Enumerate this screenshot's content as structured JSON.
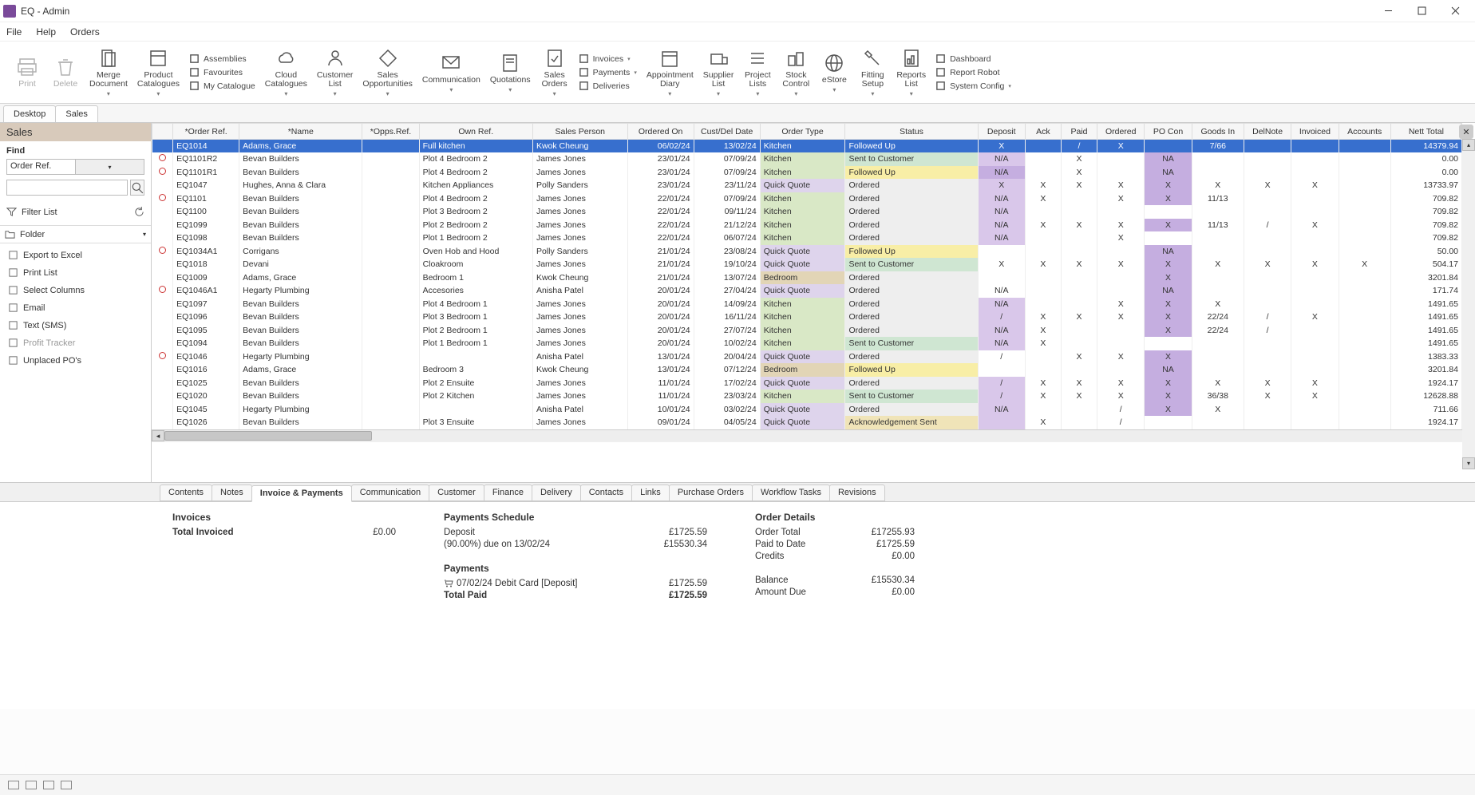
{
  "window": {
    "title": "EQ  -  Admin"
  },
  "menu": [
    "File",
    "Help",
    "Orders"
  ],
  "ribbon_main": [
    {
      "id": "print",
      "label": "Print",
      "disabled": true,
      "drop": false
    },
    {
      "id": "delete",
      "label": "Delete",
      "disabled": true,
      "drop": false
    },
    {
      "id": "merge",
      "label": "Merge\nDocument",
      "drop": true
    },
    {
      "id": "product-cat",
      "label": "Product\nCatalogues",
      "drop": true
    }
  ],
  "ribbon_side1": [
    {
      "id": "assemblies",
      "label": "Assemblies"
    },
    {
      "id": "favourites",
      "label": "Favourites"
    },
    {
      "id": "my-catalogue",
      "label": "My Catalogue"
    }
  ],
  "ribbon_mid": [
    {
      "id": "cloud-cat",
      "label": "Cloud\nCatalogues",
      "drop": true
    },
    {
      "id": "cust-list",
      "label": "Customer\nList",
      "drop": true
    },
    {
      "id": "sales-opp",
      "label": "Sales\nOpportunities",
      "drop": true
    },
    {
      "id": "comm",
      "label": "Communication",
      "drop": true
    },
    {
      "id": "quot",
      "label": "Quotations",
      "drop": true
    },
    {
      "id": "sales-orders",
      "label": "Sales\nOrders",
      "drop": true
    }
  ],
  "ribbon_side2": [
    {
      "id": "invoices",
      "label": "Invoices",
      "drop": true
    },
    {
      "id": "payments",
      "label": "Payments",
      "drop": true
    },
    {
      "id": "deliveries",
      "label": "Deliveries"
    }
  ],
  "ribbon_tail": [
    {
      "id": "appt-diary",
      "label": "Appointment\nDiary",
      "drop": true
    },
    {
      "id": "supplier-list",
      "label": "Supplier\nList",
      "drop": true
    },
    {
      "id": "project-lists",
      "label": "Project\nLists",
      "drop": true
    },
    {
      "id": "stock-ctrl",
      "label": "Stock\nControl",
      "drop": true
    },
    {
      "id": "estore",
      "label": "eStore",
      "drop": true
    },
    {
      "id": "fitting-setup",
      "label": "Fitting\nSetup",
      "drop": true
    },
    {
      "id": "reports-list",
      "label": "Reports\nList",
      "drop": true
    }
  ],
  "ribbon_side3": [
    {
      "id": "dashboard",
      "label": "Dashboard"
    },
    {
      "id": "report-robot",
      "label": "Report Robot"
    },
    {
      "id": "system-config",
      "label": "System Config",
      "drop": true
    }
  ],
  "tabs": {
    "items": [
      "Desktop",
      "Sales"
    ],
    "active": 1
  },
  "left": {
    "title": "Sales",
    "find_label": "Find",
    "find_field": "Order Ref.",
    "filter_label": "Filter List",
    "folder": "Folder",
    "actions": [
      {
        "id": "export-excel",
        "label": "Export to Excel"
      },
      {
        "id": "print-list",
        "label": "Print List"
      },
      {
        "id": "select-cols",
        "label": "Select Columns"
      },
      {
        "id": "email",
        "label": "Email"
      },
      {
        "id": "text-sms",
        "label": "Text (SMS)"
      },
      {
        "id": "profit-tracker",
        "label": "Profit Tracker",
        "disabled": true
      },
      {
        "id": "unplaced-pos",
        "label": "Unplaced PO's"
      }
    ]
  },
  "grid": {
    "columns": [
      "",
      "*Order Ref.",
      "*Name",
      "*Opps.Ref.",
      "Own Ref.",
      "Sales Person",
      "Ordered On",
      "Cust/Del Date",
      "Order Type",
      "Status",
      "Deposit",
      "Ack",
      "Paid",
      "Ordered",
      "PO Con",
      "Goods In",
      "DelNote",
      "Invoiced",
      "Accounts",
      "Nett Total"
    ],
    "rows": [
      {
        "r": "",
        "ref": "EQ1014",
        "name": "Adams, Grace",
        "opps": "",
        "own": "Full kitchen",
        "sp": "Kwok Cheung",
        "ord": "06/02/24",
        "del": "13/02/24",
        "ot": "Kitchen",
        "otc": "ot-kitchen",
        "st": "Followed Up",
        "stc": "st-followed",
        "dep": "X",
        "ack": "",
        "paid": "/",
        "ordered": "X",
        "po": "",
        "gi": "7/66",
        "dn": "",
        "inv": "",
        "acc": "",
        "net": "14379.94",
        "sel": true
      },
      {
        "r": "o",
        "ref": "EQ1101R2",
        "name": "Bevan Builders",
        "own": "Plot 4 Bedroom 2",
        "sp": "James Jones",
        "ord": "23/01/24",
        "del": "07/09/24",
        "ot": "Kitchen",
        "otc": "ot-kitchen",
        "st": "Sent to Customer",
        "stc": "st-sent",
        "dep": "N/A",
        "depc": "dep-purple",
        "ack": "",
        "paid": "X",
        "ordered": "",
        "po": "NA",
        "poc": "po-purple",
        "gi": "",
        "dn": "",
        "inv": "",
        "acc": "",
        "net": "0.00"
      },
      {
        "r": "o",
        "ref": "EQ1101R1",
        "name": "Bevan Builders",
        "own": "Plot 4 Bedroom 2",
        "sp": "James Jones",
        "ord": "23/01/24",
        "del": "07/09/24",
        "ot": "Kitchen",
        "otc": "ot-kitchen",
        "st": "Followed Up",
        "stc": "st-followed",
        "dep": "N/A",
        "depc": "dep-purple-dk",
        "ack": "",
        "paid": "X",
        "ordered": "",
        "po": "NA",
        "poc": "po-purple",
        "gi": "",
        "dn": "",
        "inv": "",
        "acc": "",
        "net": "0.00"
      },
      {
        "r": "",
        "ref": "EQ1047",
        "name": "Hughes, Anna & Clara",
        "own": "Kitchen Appliances",
        "sp": "Polly Sanders",
        "ord": "23/01/24",
        "del": "23/11/24",
        "ot": "Quick Quote",
        "otc": "ot-quick",
        "st": "Ordered",
        "stc": "st-ordered",
        "dep": "X",
        "depc": "dep-purple",
        "ack": "X",
        "paid": "X",
        "ordered": "X",
        "po": "X",
        "poc": "po-purple",
        "gi": "X",
        "dn": "X",
        "inv": "X",
        "acc": "",
        "net": "13733.97"
      },
      {
        "r": "o",
        "ref": "EQ1101",
        "name": "Bevan Builders",
        "own": "Plot 4 Bedroom 2",
        "sp": "James Jones",
        "ord": "22/01/24",
        "del": "07/09/24",
        "ot": "Kitchen",
        "otc": "ot-kitchen",
        "st": "Ordered",
        "stc": "st-ordered",
        "dep": "N/A",
        "depc": "dep-purple",
        "ack": "X",
        "paid": "",
        "ordered": "X",
        "po": "X",
        "poc": "po-purple",
        "gi": "11/13",
        "dn": "",
        "inv": "",
        "acc": "",
        "net": "709.82"
      },
      {
        "r": "",
        "ref": "EQ1100",
        "name": "Bevan Builders",
        "own": "Plot 3 Bedroom 2",
        "sp": "James Jones",
        "ord": "22/01/24",
        "del": "09/11/24",
        "ot": "Kitchen",
        "otc": "ot-kitchen",
        "st": "Ordered",
        "stc": "st-ordered",
        "dep": "N/A",
        "depc": "dep-purple",
        "ack": "",
        "paid": "",
        "ordered": "",
        "po": "",
        "gi": "",
        "dn": "",
        "inv": "",
        "acc": "",
        "net": "709.82"
      },
      {
        "r": "",
        "ref": "EQ1099",
        "name": "Bevan Builders",
        "own": "Plot 2 Bedroom 2",
        "sp": "James Jones",
        "ord": "22/01/24",
        "del": "21/12/24",
        "ot": "Kitchen",
        "otc": "ot-kitchen",
        "st": "Ordered",
        "stc": "st-ordered",
        "dep": "N/A",
        "depc": "dep-purple",
        "ack": "X",
        "paid": "X",
        "ordered": "X",
        "po": "X",
        "poc": "po-purple",
        "gi": "11/13",
        "dn": "/",
        "inv": "X",
        "acc": "",
        "net": "709.82"
      },
      {
        "r": "",
        "ref": "EQ1098",
        "name": "Bevan Builders",
        "own": "Plot 1 Bedroom 2",
        "sp": "James Jones",
        "ord": "22/01/24",
        "del": "06/07/24",
        "ot": "Kitchen",
        "otc": "ot-kitchen",
        "st": "Ordered",
        "stc": "st-ordered",
        "dep": "N/A",
        "depc": "dep-purple",
        "ack": "",
        "paid": "",
        "ordered": "X",
        "po": "",
        "gi": "",
        "dn": "",
        "inv": "",
        "acc": "",
        "net": "709.82"
      },
      {
        "r": "o",
        "ref": "EQ1034A1",
        "name": "Corrigans",
        "own": "Oven Hob and Hood",
        "sp": "Polly Sanders",
        "ord": "21/01/24",
        "del": "23/08/24",
        "ot": "Quick Quote",
        "otc": "ot-quick",
        "st": "Followed Up",
        "stc": "st-followed",
        "dep": "",
        "ack": "",
        "paid": "",
        "ordered": "",
        "po": "NA",
        "poc": "po-purple",
        "gi": "",
        "dn": "",
        "inv": "",
        "acc": "",
        "net": "50.00"
      },
      {
        "r": "",
        "ref": "EQ1018",
        "name": "Devani",
        "own": "Cloakroom",
        "sp": "James Jones",
        "ord": "21/01/24",
        "del": "19/10/24",
        "ot": "Quick Quote",
        "otc": "ot-quick",
        "st": "Sent to Customer",
        "stc": "st-sent",
        "dep": "X",
        "ack": "X",
        "paid": "X",
        "ordered": "X",
        "po": "X",
        "poc": "po-purple",
        "gi": "X",
        "dn": "X",
        "inv": "X",
        "acc": "X",
        "net": "504.17"
      },
      {
        "r": "",
        "ref": "EQ1009",
        "name": "Adams, Grace",
        "own": "Bedroom 1",
        "sp": "Kwok Cheung",
        "ord": "21/01/24",
        "del": "13/07/24",
        "ot": "Bedroom",
        "otc": "ot-bedroom",
        "st": "Ordered",
        "stc": "st-ordered",
        "dep": "",
        "ack": "",
        "paid": "",
        "ordered": "",
        "po": "X",
        "poc": "po-purple",
        "gi": "",
        "dn": "",
        "inv": "",
        "acc": "",
        "net": "3201.84"
      },
      {
        "r": "o",
        "ref": "EQ1046A1",
        "name": "Hegarty Plumbing",
        "own": "Accesories",
        "sp": "Anisha Patel",
        "ord": "20/01/24",
        "del": "27/04/24",
        "ot": "Quick Quote",
        "otc": "ot-quick",
        "st": "Ordered",
        "stc": "st-ordered",
        "dep": "N/A",
        "ack": "",
        "paid": "",
        "ordered": "",
        "po": "NA",
        "poc": "po-purple",
        "gi": "",
        "dn": "",
        "inv": "",
        "acc": "",
        "net": "171.74"
      },
      {
        "r": "",
        "ref": "EQ1097",
        "name": "Bevan Builders",
        "own": "Plot 4 Bedroom 1",
        "sp": "James Jones",
        "ord": "20/01/24",
        "del": "14/09/24",
        "ot": "Kitchen",
        "otc": "ot-kitchen",
        "st": "Ordered",
        "stc": "st-ordered",
        "dep": "N/A",
        "depc": "dep-purple",
        "ack": "",
        "paid": "",
        "ordered": "X",
        "po": "X",
        "poc": "po-purple",
        "gi": "X",
        "dn": "",
        "inv": "",
        "acc": "",
        "net": "1491.65"
      },
      {
        "r": "",
        "ref": "EQ1096",
        "name": "Bevan Builders",
        "own": "Plot 3 Bedroom 1",
        "sp": "James Jones",
        "ord": "20/01/24",
        "del": "16/11/24",
        "ot": "Kitchen",
        "otc": "ot-kitchen",
        "st": "Ordered",
        "stc": "st-ordered",
        "dep": "/",
        "depc": "dep-purple",
        "ack": "X",
        "paid": "X",
        "ordered": "X",
        "po": "X",
        "poc": "po-purple",
        "gi": "22/24",
        "dn": "/",
        "inv": "X",
        "acc": "",
        "net": "1491.65"
      },
      {
        "r": "",
        "ref": "EQ1095",
        "name": "Bevan Builders",
        "own": "Plot 2 Bedroom 1",
        "sp": "James Jones",
        "ord": "20/01/24",
        "del": "27/07/24",
        "ot": "Kitchen",
        "otc": "ot-kitchen",
        "st": "Ordered",
        "stc": "st-ordered",
        "dep": "N/A",
        "depc": "dep-purple",
        "ack": "X",
        "paid": "",
        "ordered": "",
        "po": "X",
        "poc": "po-purple",
        "gi": "22/24",
        "dn": "/",
        "inv": "",
        "acc": "",
        "net": "1491.65"
      },
      {
        "r": "",
        "ref": "EQ1094",
        "name": "Bevan Builders",
        "own": "Plot 1 Bedroom 1",
        "sp": "James Jones",
        "ord": "20/01/24",
        "del": "10/02/24",
        "ot": "Kitchen",
        "otc": "ot-kitchen",
        "st": "Sent to Customer",
        "stc": "st-sent",
        "dep": "N/A",
        "depc": "dep-purple",
        "ack": "X",
        "paid": "",
        "ordered": "",
        "po": "",
        "gi": "",
        "dn": "",
        "inv": "",
        "acc": "",
        "net": "1491.65"
      },
      {
        "r": "o",
        "ref": "EQ1046",
        "name": "Hegarty Plumbing",
        "own": "",
        "sp": "Anisha Patel",
        "ord": "13/01/24",
        "del": "20/04/24",
        "ot": "Quick Quote",
        "otc": "ot-quick",
        "st": "Ordered",
        "stc": "st-ordered",
        "dep": "/",
        "ack": "",
        "paid": "X",
        "ordered": "X",
        "po": "X",
        "poc": "po-purple",
        "gi": "",
        "dn": "",
        "inv": "",
        "acc": "",
        "net": "1383.33"
      },
      {
        "r": "",
        "ref": "EQ1016",
        "name": "Adams, Grace",
        "own": "Bedroom 3",
        "sp": "Kwok Cheung",
        "ord": "13/01/24",
        "del": "07/12/24",
        "ot": "Bedroom",
        "otc": "ot-bedroom",
        "st": "Followed Up",
        "stc": "st-followed",
        "dep": "",
        "ack": "",
        "paid": "",
        "ordered": "",
        "po": "NA",
        "poc": "po-purple",
        "gi": "",
        "dn": "",
        "inv": "",
        "acc": "",
        "net": "3201.84"
      },
      {
        "r": "",
        "ref": "EQ1025",
        "name": "Bevan Builders",
        "own": "Plot 2 Ensuite",
        "sp": "James Jones",
        "ord": "11/01/24",
        "del": "17/02/24",
        "ot": "Quick Quote",
        "otc": "ot-quick",
        "st": "Ordered",
        "stc": "st-ordered",
        "dep": "/",
        "depc": "dep-purple",
        "ack": "X",
        "paid": "X",
        "ordered": "X",
        "po": "X",
        "poc": "po-purple",
        "gi": "X",
        "dn": "X",
        "inv": "X",
        "acc": "",
        "net": "1924.17"
      },
      {
        "r": "",
        "ref": "EQ1020",
        "name": "Bevan Builders",
        "own": "Plot 2 Kitchen",
        "sp": "James Jones",
        "ord": "11/01/24",
        "del": "23/03/24",
        "ot": "Kitchen",
        "otc": "ot-kitchen",
        "st": "Sent to Customer",
        "stc": "st-sent",
        "dep": "/",
        "depc": "dep-purple",
        "ack": "X",
        "paid": "X",
        "ordered": "X",
        "po": "X",
        "poc": "po-purple",
        "gi": "36/38",
        "dn": "X",
        "inv": "X",
        "acc": "",
        "net": "12628.88"
      },
      {
        "r": "",
        "ref": "EQ1045",
        "name": "Hegarty Plumbing",
        "own": "",
        "sp": "Anisha Patel",
        "ord": "10/01/24",
        "del": "03/02/24",
        "ot": "Quick Quote",
        "otc": "ot-quick",
        "st": "Ordered",
        "stc": "st-ordered",
        "dep": "N/A",
        "depc": "dep-purple",
        "ack": "",
        "paid": "",
        "ordered": "/",
        "po": "X",
        "poc": "po-purple",
        "gi": "X",
        "dn": "",
        "inv": "",
        "acc": "",
        "net": "711.66"
      },
      {
        "r": "",
        "ref": "EQ1026",
        "name": "Bevan Builders",
        "own": "Plot 3 Ensuite",
        "sp": "James Jones",
        "ord": "09/01/24",
        "del": "04/05/24",
        "ot": "Quick Quote",
        "otc": "ot-quick",
        "st": "Acknowledgement Sent",
        "stc": "st-ack",
        "dep": "",
        "depc": "dep-purple",
        "ack": "X",
        "paid": "",
        "ordered": "/",
        "po": "",
        "gi": "",
        "dn": "",
        "inv": "",
        "acc": "",
        "net": "1924.17"
      }
    ]
  },
  "detail_tabs": {
    "items": [
      "Contents",
      "Notes",
      "Invoice & Payments",
      "Communication",
      "Customer",
      "Finance",
      "Delivery",
      "Contacts",
      "Links",
      "Purchase Orders",
      "Workflow Tasks",
      "Revisions"
    ],
    "active": 2
  },
  "detail": {
    "invoices_h": "Invoices",
    "total_invoiced_k": "Total Invoiced",
    "total_invoiced_v": "£0.00",
    "sched_h": "Payments Schedule",
    "sched1_k": "   Deposit",
    "sched1_v": "£1725.59",
    "sched2_k": "   (90.00%) due on 13/02/24",
    "sched2_v": "£15530.34",
    "payments_h": "Payments",
    "pay1_k": "07/02/24 Debit Card [Deposit]",
    "pay1_v": "£1725.59",
    "total_paid_k": "Total Paid",
    "total_paid_v": "£1725.59",
    "orderdet_h": "Order Details",
    "od1_k": "Order Total",
    "od1_v": "£17255.93",
    "od2_k": "Paid to Date",
    "od2_v": "£1725.59",
    "od3_k": "Credits",
    "od3_v": "£0.00",
    "od4_k": "Balance",
    "od4_v": "£15530.34",
    "od5_k": "Amount Due",
    "od5_v": "£0.00"
  }
}
